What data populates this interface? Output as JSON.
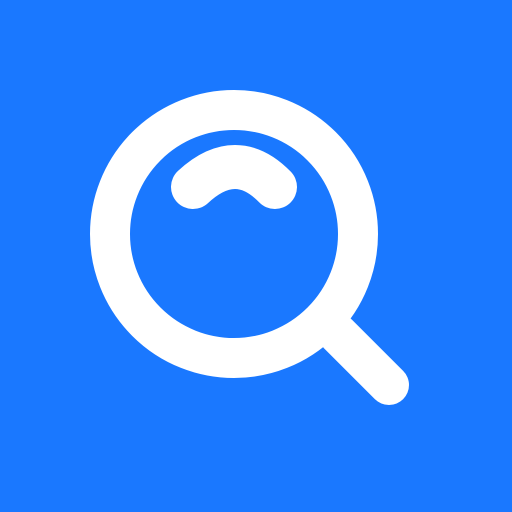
{
  "icon": {
    "name": "search-icon",
    "background_color": "#1a78ff",
    "glyph_color": "#ffffff"
  }
}
